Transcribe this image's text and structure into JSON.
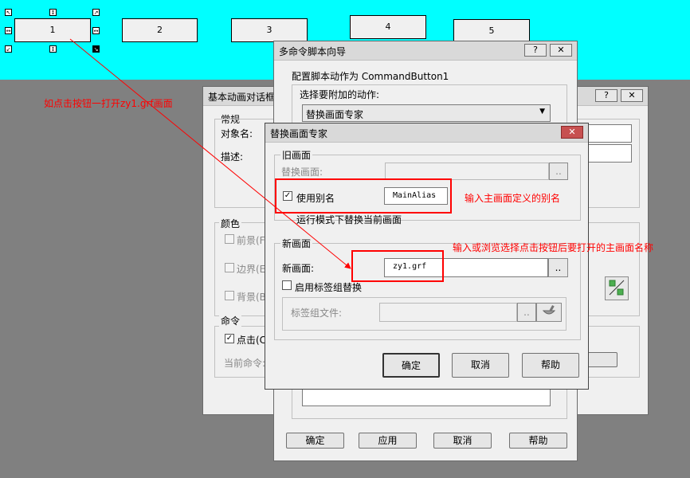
{
  "canvas_buttons": [
    "1",
    "2",
    "3",
    "4",
    "5"
  ],
  "colors": {
    "canvas_bg": "#00ffff",
    "desktop_bg": "#808080",
    "annotation": "#ff0000",
    "close_button": "#c75050"
  },
  "basic_dialog": {
    "title": "基本动画对话框",
    "general_group": "常规",
    "object_name_label": "对象名:",
    "description_label": "描述:",
    "color_group": "颜色",
    "foreground_label": "前景(F",
    "border_label": "边界(E",
    "background_label": "背景(B",
    "command_group": "命令",
    "click_label": "点击(C",
    "current_command_label": "当前命令:"
  },
  "wizard": {
    "title": "多命令脚本向导",
    "configure_text": "配置脚本动作为 CommandButton1",
    "select_action_label": "选择要附加的动作:",
    "action_value": "替换画面专家",
    "buttons": {
      "ok": "确定",
      "apply": "应用",
      "cancel": "取消",
      "help": "帮助"
    }
  },
  "expert": {
    "title": "替换画面专家",
    "old_group": "旧画面",
    "replace_label": "替换画面:",
    "use_alias_label": "使用别名",
    "alias_value": "MainAlias",
    "runtime_label": "运行模式下替换当前画面",
    "new_group": "新画面",
    "new_label": "新画面:",
    "new_value": "zy1.grf",
    "tag_group_label": "启用标签组替换",
    "tag_file_label": "标签组文件:",
    "browse": "..",
    "buttons": {
      "ok": "确定",
      "cancel": "取消",
      "help": "帮助"
    }
  },
  "annotations": {
    "click_open": "如点击按钮一打开zy1.grf画面",
    "alias_hint": "输入主画面定义的别名",
    "browse_hint": "输入或浏览选择点击按钮后要打开的主画面名称"
  }
}
